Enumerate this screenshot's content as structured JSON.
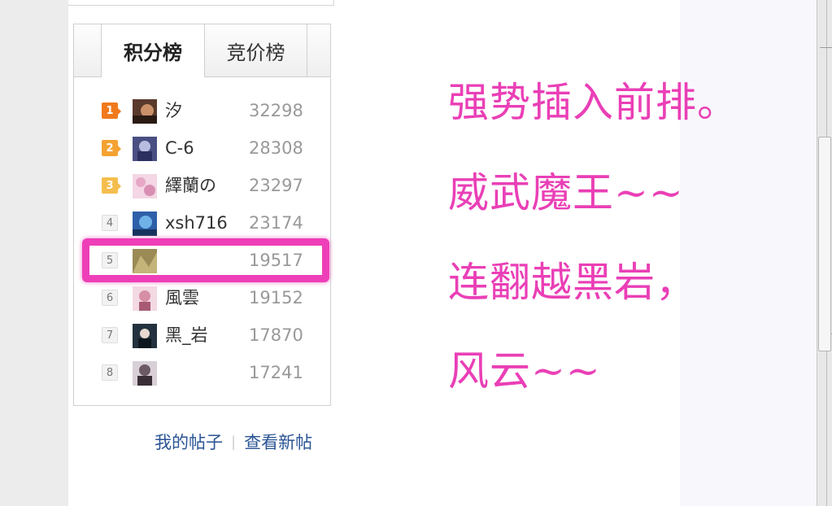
{
  "tabs": {
    "active": "积分榜",
    "inactive": "竞价榜"
  },
  "ranking": [
    {
      "rank": "1",
      "name": "汐",
      "score": "32298",
      "avatar_color": "#5a3a2c"
    },
    {
      "rank": "2",
      "name": "C-6",
      "score": "28308",
      "avatar_color": "#4a4f82"
    },
    {
      "rank": "3",
      "name": "繹蘭の",
      "score": "23297",
      "avatar_color": "#e7a8c5"
    },
    {
      "rank": "4",
      "name": "xsh716",
      "score": "23174",
      "avatar_color": "#2e5fa8"
    },
    {
      "rank": "5",
      "name": "",
      "score": "19517",
      "avatar_color": "#9a8a56"
    },
    {
      "rank": "6",
      "name": "風雲",
      "score": "19152",
      "avatar_color": "#d78fa6"
    },
    {
      "rank": "7",
      "name": "黑_岩",
      "score": "17870",
      "avatar_color": "#23323e"
    },
    {
      "rank": "8",
      "name": "",
      "score": "17241",
      "avatar_color": "#6b5a64"
    }
  ],
  "footer": {
    "my_posts": "我的帖子",
    "separator": "|",
    "new_posts": "查看新帖"
  },
  "annotations": [
    "强势插入前排。",
    "威武魔王~~",
    "连翻越黑岩，",
    "风云~~"
  ],
  "colors": {
    "highlight": "#ee3fb8",
    "annotation": "#ea3fb6",
    "link": "#2a5494"
  }
}
